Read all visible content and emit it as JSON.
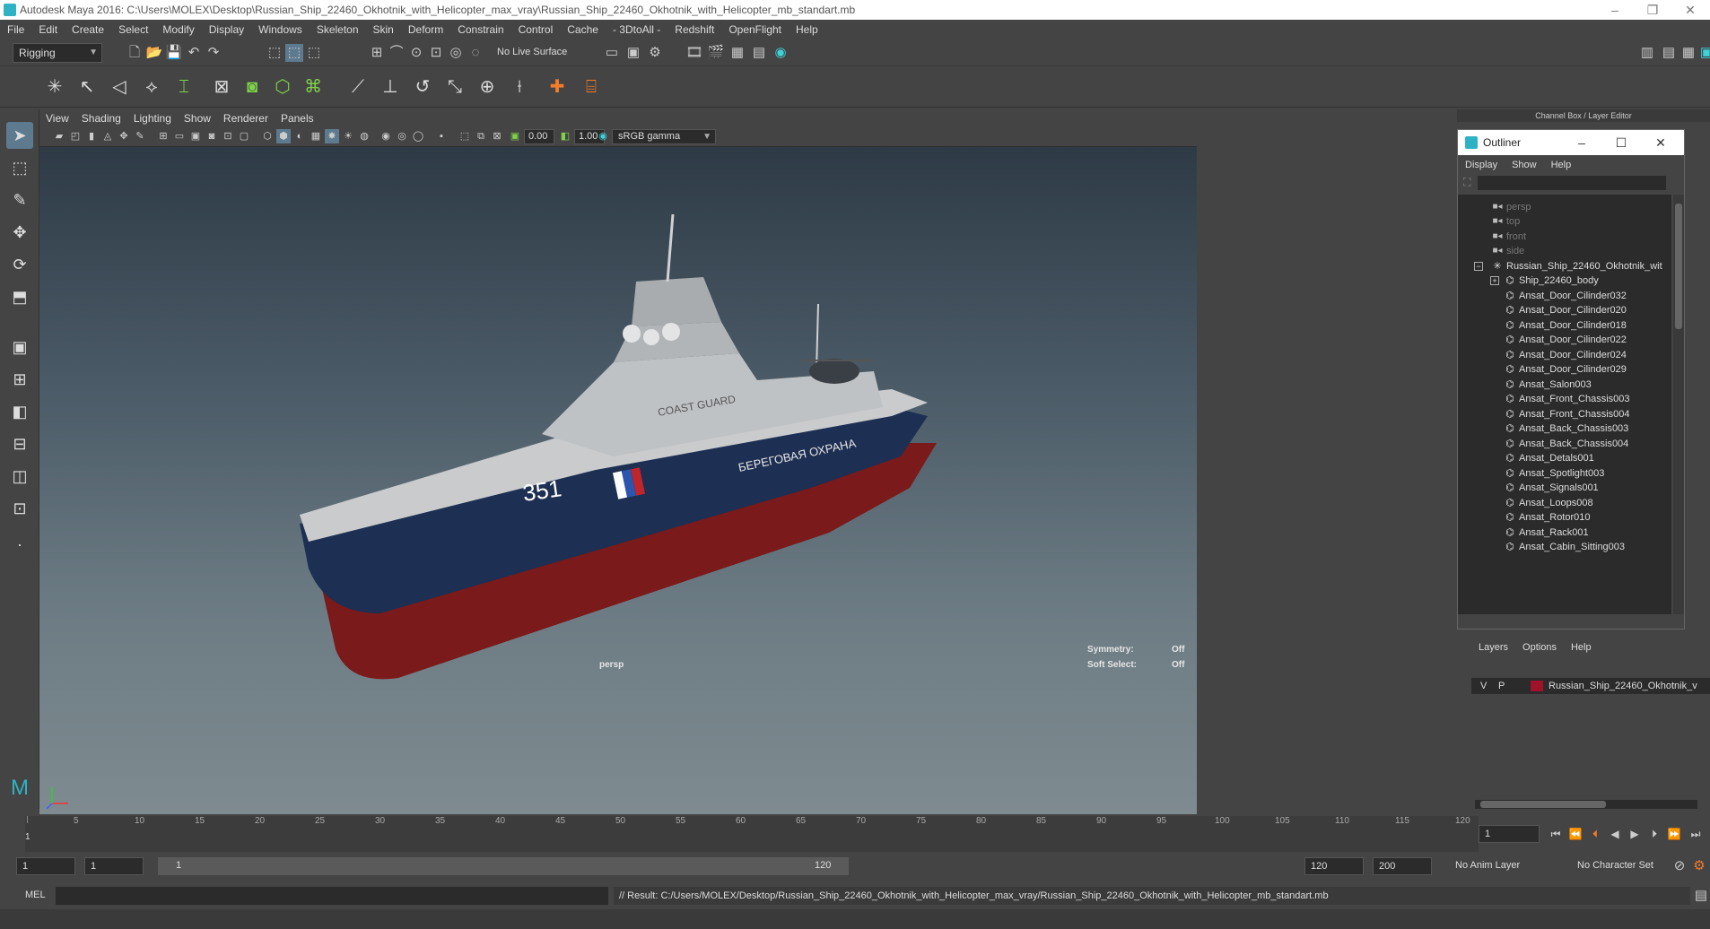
{
  "window": {
    "title": "Autodesk Maya 2016: C:\\Users\\MOLEX\\Desktop\\Russian_Ship_22460_Okhotnik_with_Helicopter_max_vray\\Russian_Ship_22460_Okhotnik_with_Helicopter_mb_standart.mb",
    "minimize": "–",
    "restore": "❐",
    "close": "✕"
  },
  "menu": [
    "File",
    "Edit",
    "Create",
    "Select",
    "Modify",
    "Display",
    "Windows",
    "Skeleton",
    "Skin",
    "Deform",
    "Constrain",
    "Control",
    "Cache",
    "- 3DtoAll -",
    "Redshift",
    "OpenFlight",
    "Help"
  ],
  "status": {
    "mode": "Rigging",
    "live_surface": "No Live Surface"
  },
  "panel_menu": [
    "View",
    "Shading",
    "Lighting",
    "Show",
    "Renderer",
    "Panels"
  ],
  "panel_toolbar": {
    "exposure": "0.00",
    "gamma": "1.00",
    "color_space": "sRGB gamma"
  },
  "viewport": {
    "camera": "persp",
    "symmetry_label": "Symmetry:",
    "symmetry_value": "Off",
    "soft_select_label": "Soft Select:",
    "soft_select_value": "Off",
    "ship_text_1": "COAST GUARD",
    "ship_text_2": "БЕРЕГОВАЯ ОХРАНА",
    "ship_number": "351"
  },
  "channel_box_title": "Channel Box / Layer Editor",
  "outliner": {
    "title": "Outliner",
    "menu": [
      "Display",
      "Show",
      "Help"
    ],
    "items": [
      {
        "label": "persp",
        "kind": "camera"
      },
      {
        "label": "top",
        "kind": "camera"
      },
      {
        "label": "front",
        "kind": "camera"
      },
      {
        "label": "side",
        "kind": "camera"
      },
      {
        "label": "Russian_Ship_22460_Okhotnik_wit",
        "kind": "root"
      },
      {
        "label": "Ship_22460_body",
        "kind": "group"
      },
      {
        "label": "Ansat_Door_Cilinder032",
        "kind": "mesh"
      },
      {
        "label": "Ansat_Door_Cilinder020",
        "kind": "mesh"
      },
      {
        "label": "Ansat_Door_Cilinder018",
        "kind": "mesh"
      },
      {
        "label": "Ansat_Door_Cilinder022",
        "kind": "mesh"
      },
      {
        "label": "Ansat_Door_Cilinder024",
        "kind": "mesh"
      },
      {
        "label": "Ansat_Door_Cilinder029",
        "kind": "mesh"
      },
      {
        "label": "Ansat_Salon003",
        "kind": "mesh"
      },
      {
        "label": "Ansat_Front_Chassis003",
        "kind": "mesh"
      },
      {
        "label": "Ansat_Front_Chassis004",
        "kind": "mesh"
      },
      {
        "label": "Ansat_Back_Chassis003",
        "kind": "mesh"
      },
      {
        "label": "Ansat_Back_Chassis004",
        "kind": "mesh"
      },
      {
        "label": "Ansat_Detals001",
        "kind": "mesh"
      },
      {
        "label": "Ansat_Spotlight003",
        "kind": "mesh"
      },
      {
        "label": "Ansat_Signals001",
        "kind": "mesh"
      },
      {
        "label": "Ansat_Loops008",
        "kind": "mesh"
      },
      {
        "label": "Ansat_Rotor010",
        "kind": "mesh"
      },
      {
        "label": "Ansat_Rack001",
        "kind": "mesh"
      },
      {
        "label": "Ansat_Cabin_Sitting003",
        "kind": "mesh"
      }
    ]
  },
  "layers": {
    "menu": [
      "Layers",
      "Options",
      "Help"
    ],
    "row": {
      "v": "V",
      "p": "P",
      "name": "Russian_Ship_22460_Okhotnik_v",
      "color": "#a0122a"
    }
  },
  "timeline": {
    "ticks": [
      "1",
      "5",
      "10",
      "15",
      "20",
      "25",
      "30",
      "35",
      "40",
      "45",
      "50",
      "55",
      "60",
      "65",
      "70",
      "75",
      "80",
      "85",
      "90",
      "95",
      "100",
      "105",
      "110",
      "115",
      "120"
    ],
    "current_frame": "1"
  },
  "range": {
    "start": "1",
    "playback_start": "1",
    "slider_start": "1",
    "slider_end": "120",
    "playback_end": "120",
    "end": "200",
    "anim_layer": "No Anim Layer",
    "character_set": "No Character Set"
  },
  "command": {
    "lang": "MEL",
    "result": "// Result: C:/Users/MOLEX/Desktop/Russian_Ship_22460_Okhotnik_with_Helicopter_max_vray/Russian_Ship_22460_Okhotnik_with_Helicopter_mb_standart.mb"
  }
}
